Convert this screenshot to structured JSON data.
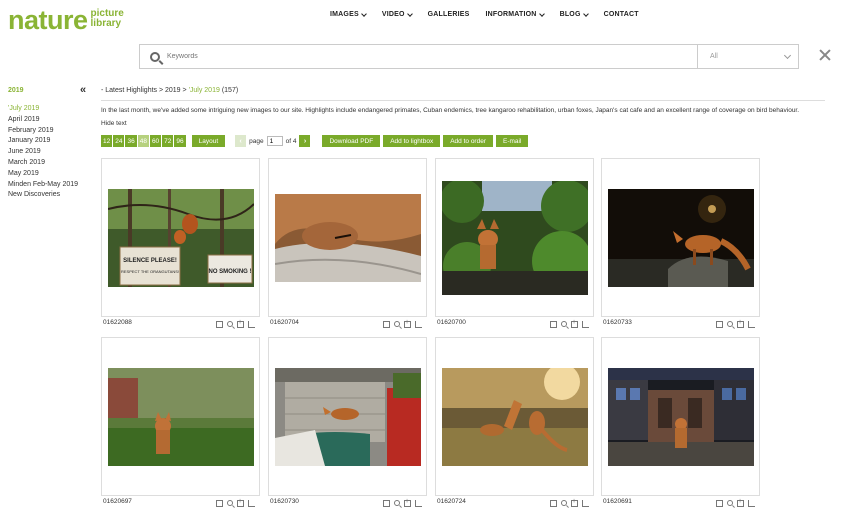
{
  "header": {
    "logo_word": "nature",
    "logo_sub1": "picture",
    "logo_sub2": "library",
    "nav": [
      {
        "label": "IMAGES",
        "dropdown": true
      },
      {
        "label": "VIDEO",
        "dropdown": true
      },
      {
        "label": "GALLERIES",
        "dropdown": false
      },
      {
        "label": "INFORMATION",
        "dropdown": true
      },
      {
        "label": "BLOG",
        "dropdown": true
      },
      {
        "label": "CONTACT",
        "dropdown": false
      }
    ]
  },
  "search": {
    "placeholder": "Keywords",
    "scope": "All"
  },
  "sidebar": {
    "collapse_glyph": "«",
    "year": "2019",
    "items": [
      {
        "label": "'July 2019",
        "active": true
      },
      {
        "label": "April 2019"
      },
      {
        "label": "February 2019"
      },
      {
        "label": "January 2019"
      },
      {
        "label": "June 2019"
      },
      {
        "label": "March 2019"
      },
      {
        "label": "May 2019"
      },
      {
        "label": "Minden Feb-May 2019"
      },
      {
        "label": "New Discoveries"
      }
    ]
  },
  "breadcrumb": {
    "prefix": "- Latest Highlights > 2019 > ",
    "current": "'July 2019",
    "count": "(157)"
  },
  "intro": "In the last month, we've added some intriguing new images to our site. Highlights include endangered primates, Cuban endemics, tree kangaroo rehabilitation, urban foxes, Japan's cat cafe and an excellent range of coverage on bird behaviour.",
  "hide_text": "Hide text",
  "toolbar": {
    "per_page": [
      "12",
      "24",
      "36",
      "48",
      "60",
      "72",
      "96"
    ],
    "per_page_selected": "48",
    "layout": "Layout",
    "page_label": "page",
    "page_value": "1",
    "page_total": "of 4",
    "download_pdf": "Download PDF",
    "add_lightbox": "Add to lightbox",
    "add_order": "Add to order",
    "email": "E-mail"
  },
  "images": [
    {
      "code": "01622088",
      "subject": "orangutans-signs"
    },
    {
      "code": "01620704",
      "subject": "fox-sleeping"
    },
    {
      "code": "01620700",
      "subject": "fox-garden"
    },
    {
      "code": "01620733",
      "subject": "fox-night"
    },
    {
      "code": "01620697",
      "subject": "fox-grass"
    },
    {
      "code": "01620730",
      "subject": "fox-shed"
    },
    {
      "code": "01620724",
      "subject": "foxes-play"
    },
    {
      "code": "01620691",
      "subject": "fox-street"
    }
  ],
  "colors": {
    "brand": "#8ab435",
    "button": "#7aaa2a"
  }
}
